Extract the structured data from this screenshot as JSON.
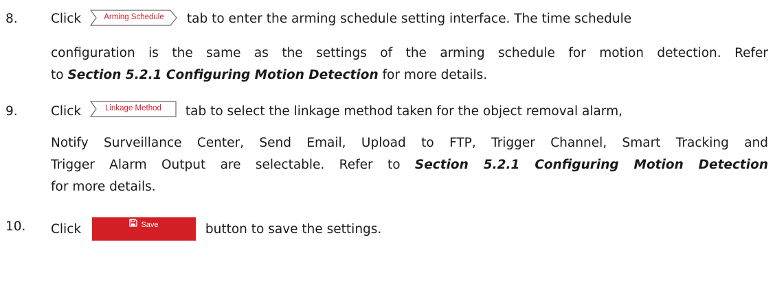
{
  "steps": [
    {
      "number": "8.",
      "prefix": "Click",
      "button_label": "Arming Schedule",
      "line1_rest": "tab to enter the arming schedule setting interface. The time schedule",
      "line2": "configuration is the same as the settings of the arming schedule for motion detection. Refer",
      "line3_pre": "to",
      "line3_ref": "Section 5.2.1 Configuring Motion Detection",
      "line3_post": "for more details."
    },
    {
      "number": "9.",
      "prefix": "Click",
      "button_label": "Linkage Method",
      "line1_rest": "tab to select the linkage method taken for the object removal alarm,",
      "line2": "Notify Surveillance Center, Send Email, Upload to FTP, Trigger Channel, Smart Tracking and",
      "line3_pre": "Trigger Alarm Output are selectable. Refer to",
      "line3_ref": "Section 5.2.1 Configuring Motion Detection",
      "line4": "for more details."
    },
    {
      "number": "10.",
      "prefix": "Click",
      "button_label": "Save",
      "line1_rest": "button to save the settings."
    }
  ],
  "colors": {
    "accent": "#d41f26",
    "text": "#1a1a1a"
  },
  "icons": {
    "save_icon": "floppy-disk-icon"
  }
}
